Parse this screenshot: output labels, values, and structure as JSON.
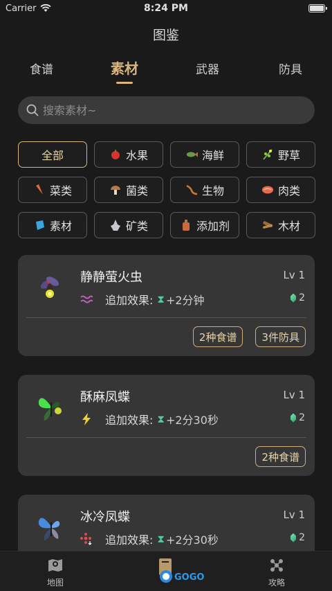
{
  "status": {
    "carrier": "Carrier",
    "time": "8:24 PM"
  },
  "title": "图鉴",
  "tabs": [
    {
      "label": "食谱",
      "active": false
    },
    {
      "label": "素材",
      "active": true
    },
    {
      "label": "武器",
      "active": false
    },
    {
      "label": "防具",
      "active": false
    }
  ],
  "search": {
    "placeholder": "搜索素材~"
  },
  "filters": [
    {
      "label": "全部",
      "icon": "",
      "active": true
    },
    {
      "label": "水果",
      "icon": "apple-icon"
    },
    {
      "label": "海鲜",
      "icon": "fish-icon"
    },
    {
      "label": "野草",
      "icon": "herb-icon"
    },
    {
      "label": "菜类",
      "icon": "carrot-icon"
    },
    {
      "label": "菌类",
      "icon": "mushroom-icon"
    },
    {
      "label": "生物",
      "icon": "lizard-icon"
    },
    {
      "label": "肉类",
      "icon": "meat-icon"
    },
    {
      "label": "素材",
      "icon": "crystal-icon"
    },
    {
      "label": "矿类",
      "icon": "ore-icon"
    },
    {
      "label": "添加剂",
      "icon": "bottle-icon"
    },
    {
      "label": "木材",
      "icon": "wood-icon"
    }
  ],
  "items": [
    {
      "name": "静静萤火虫",
      "level": "Lv 1",
      "effect_label": "追加效果:",
      "effect_icon": "stealth-icon",
      "effect_time": "+2分钟",
      "gems": "2",
      "tags": [
        "2种食谱",
        "3件防具"
      ]
    },
    {
      "name": "酥麻凤蝶",
      "level": "Lv 1",
      "effect_label": "追加效果:",
      "effect_icon": "lightning-icon",
      "effect_time": "+2分30秒",
      "gems": "2",
      "tags": [
        "2种食谱"
      ]
    },
    {
      "name": "冰冷凤蝶",
      "level": "Lv 1",
      "effect_label": "追加效果:",
      "effect_icon": "cold-resist-icon",
      "effect_time": "+2分30秒",
      "gems": "2",
      "tags": []
    }
  ],
  "nav": {
    "map": "地图",
    "guide": "攻略"
  },
  "colors": {
    "accent": "#d9b77f",
    "background": "#1a1a1a",
    "card": "#363636",
    "timer": "#55c8a8"
  }
}
